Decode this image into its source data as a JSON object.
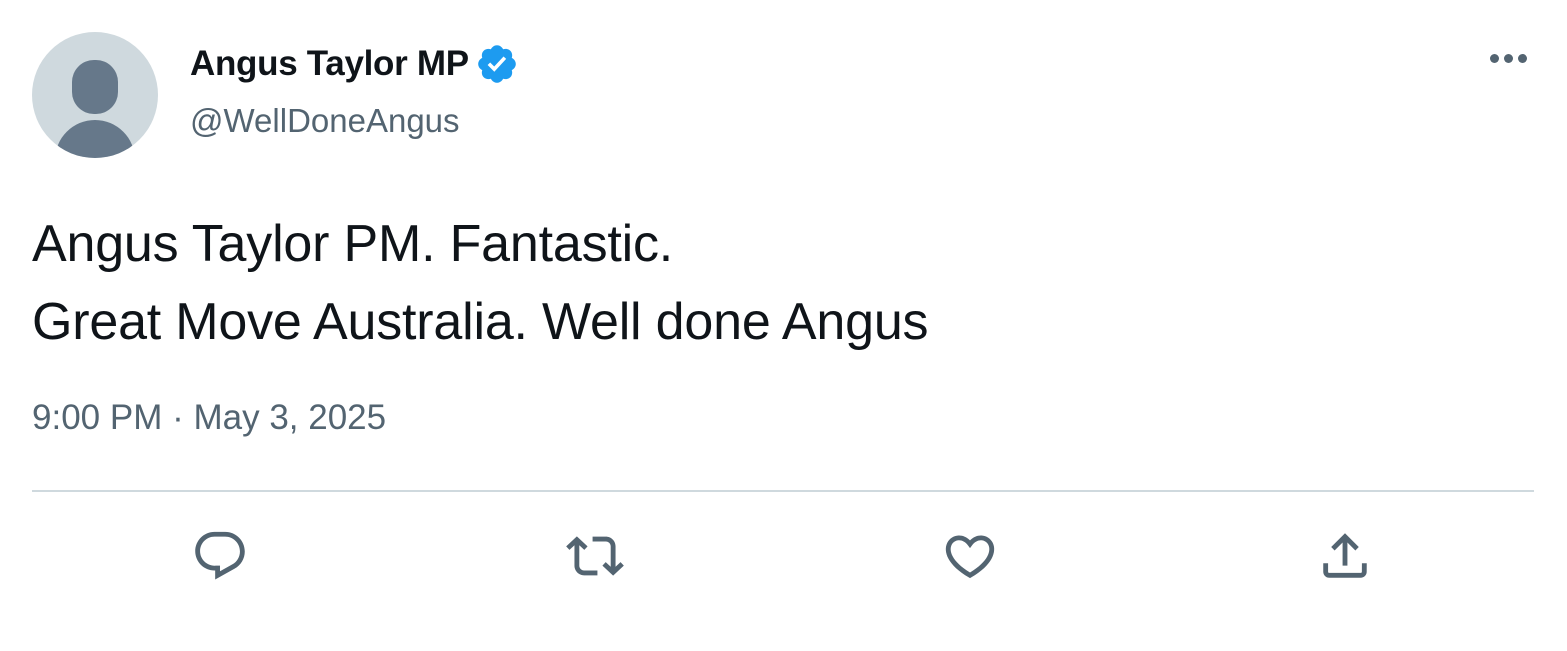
{
  "author": {
    "display_name": "Angus Taylor MP",
    "handle": "@WellDoneAngus",
    "verified": true,
    "verified_color": "#1d9bf0"
  },
  "tweet": {
    "lines": [
      "Angus Taylor PM. Fantastic.",
      "Great Move Australia. Well done Angus"
    ],
    "time": "9:00 PM",
    "separator": "·",
    "date": "May 3, 2025"
  },
  "actions": [
    {
      "icon": "reply-icon"
    },
    {
      "icon": "retweet-icon"
    },
    {
      "icon": "like-icon"
    },
    {
      "icon": "share-icon"
    }
  ],
  "colors": {
    "text_primary": "#0f1419",
    "text_secondary": "#536471",
    "divider": "#cfd9de",
    "icon": "#536471"
  }
}
